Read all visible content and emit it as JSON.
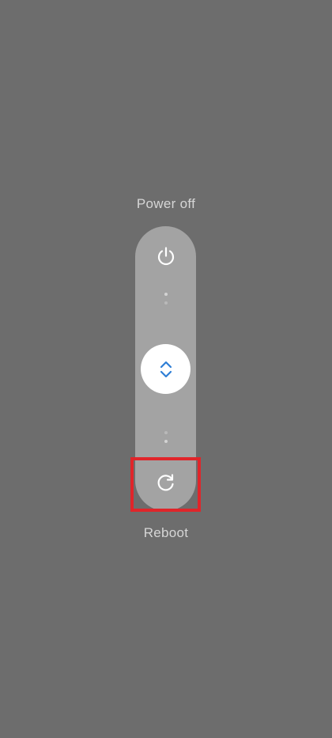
{
  "power_menu": {
    "top_label": "Power off",
    "bottom_label": "Reboot",
    "icons": {
      "top": "power-icon",
      "knob": "up-down-chevron-icon",
      "bottom": "reboot-icon"
    }
  },
  "colors": {
    "background": "#6d6d6d",
    "track": "#a3a3a3",
    "knob": "#ffffff",
    "knob_arrows": "#2f7fd6",
    "label_text": "#d6d6d6",
    "highlight": "#e0252a"
  }
}
